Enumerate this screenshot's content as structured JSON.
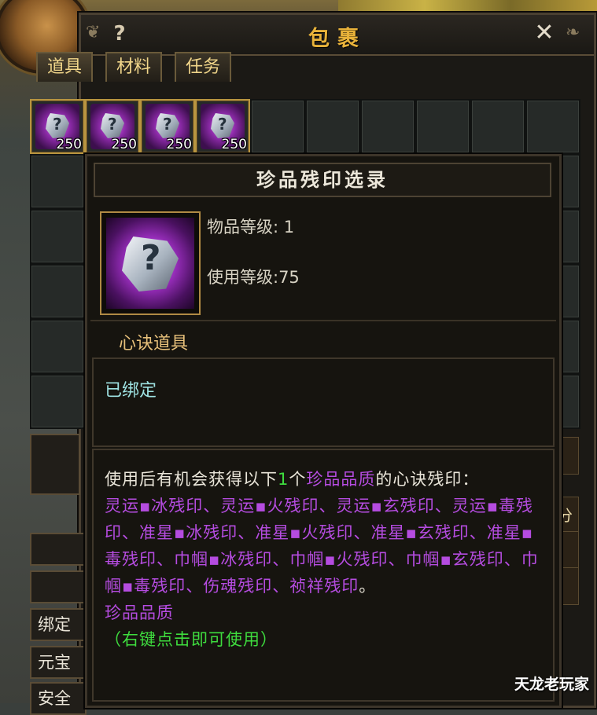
{
  "window": {
    "title": "包裹",
    "help_label": "?",
    "close_label": "✕"
  },
  "tabs": [
    "道具",
    "材料",
    "任务"
  ],
  "grid": {
    "items": [
      {
        "count": "250",
        "icon": "stone-fragment-icon"
      },
      {
        "count": "250",
        "icon": "stone-fragment-icon"
      },
      {
        "count": "250",
        "icon": "stone-fragment-icon"
      },
      {
        "count": "250",
        "icon": "stone-fragment-icon"
      }
    ]
  },
  "side": {
    "bound_label": "绑定元",
    "ingot_label": "元宝",
    "safety_label": "安全",
    "right_label": "分"
  },
  "tooltip": {
    "name": "珍品残印选录",
    "item_level": "物品等级: 1",
    "use_level": "使用等级:75",
    "category": "心诀道具",
    "bound": "已绑定",
    "desc_prefix": "使用后有机会获得以下",
    "desc_count": "1",
    "desc_mid": "个",
    "desc_quality": "珍品品质",
    "desc_suffix": "的心诀残印：",
    "seal_list": "灵运▪冰残印、灵运▪火残印、灵运▪玄残印、灵运▪毒残印、准星▪冰残印、准星▪火残印、准星▪玄残印、准星▪毒残印、巾帼▪冰残印、巾帼▪火残印、巾帼▪玄残印、巾帼▪毒残印、伤魂残印、祯祥残印",
    "end_mark": "。",
    "quality_line": "珍品品质",
    "usage_hint": "（右键点击即可使用）"
  },
  "watermark": "天龙老玩家",
  "colors": {
    "title_gold": "#e8b23a",
    "quality_purple": "#b54ce0",
    "hint_green": "#3edc3e",
    "bound_cyan": "#9fe3e3"
  }
}
